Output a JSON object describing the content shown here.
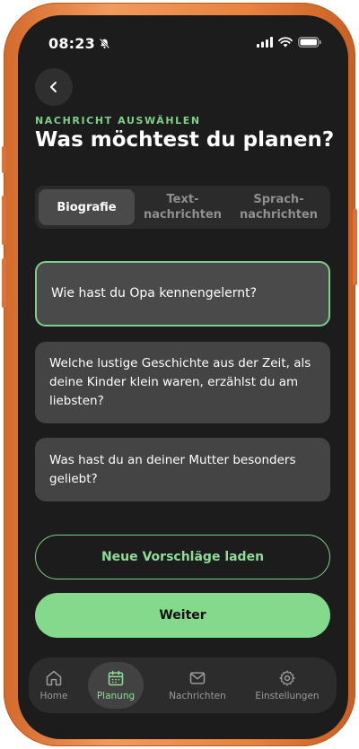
{
  "status_bar": {
    "time": "08:23"
  },
  "header": {
    "overline": "NACHRICHT AUSWÄHLEN",
    "title": "Was möchtest du planen?"
  },
  "tabs": [
    {
      "label": "Biografie",
      "active": true
    },
    {
      "label": "Text-\nnachrichten",
      "active": false
    },
    {
      "label": "Sprach-\nnachrichten",
      "active": false
    }
  ],
  "questions": [
    {
      "text": "Wie hast du Opa kennengelernt?",
      "selected": true
    },
    {
      "text": "Welche lustige Geschichte aus der Zeit, als deine Kinder klein waren, erzählst du am liebsten?",
      "selected": false
    },
    {
      "text": "Was hast du an deiner Mutter besonders geliebt?",
      "selected": false
    }
  ],
  "actions": {
    "load_more": "Neue Vorschläge laden",
    "next": "Weiter"
  },
  "nav": [
    {
      "label": "Home",
      "icon": "home-icon",
      "active": false
    },
    {
      "label": "Planung",
      "icon": "calendar-icon",
      "active": true
    },
    {
      "label": "Nachrichten",
      "icon": "mail-icon",
      "active": false
    },
    {
      "label": "Einstellungen",
      "icon": "gear-icon",
      "active": false
    }
  ],
  "colors": {
    "accent": "#7fcf8a",
    "background": "#1c1c1c",
    "card": "#444444",
    "frame": "#e8823f"
  }
}
